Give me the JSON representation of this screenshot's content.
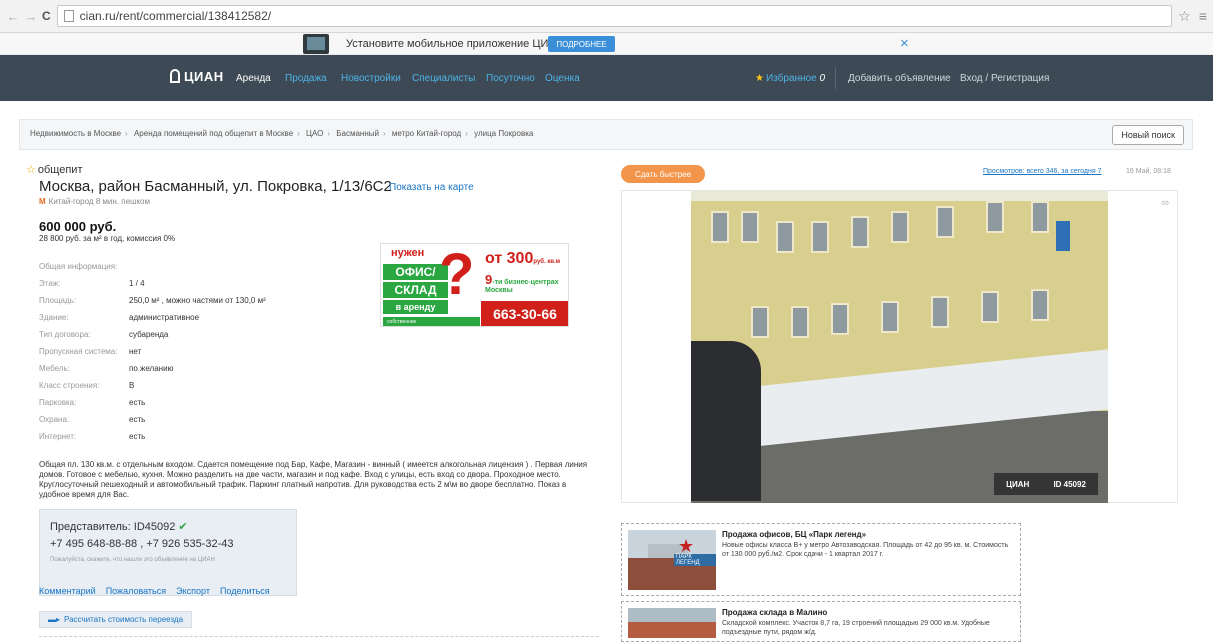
{
  "browser": {
    "url": "cian.ru/rent/commercial/138412582/",
    "back_icon": "←",
    "forward_icon": "→",
    "reload_icon": "C",
    "star_icon": "☆",
    "menu_icon": "≡"
  },
  "promo": {
    "text": "Установите мобильное приложение ЦИАН",
    "button": "ПОДРОБНЕЕ",
    "close": "×"
  },
  "nav": {
    "logo": "ЦИАН",
    "items": [
      "Аренда",
      "Продажа",
      "Новостройки",
      "Специалисты",
      "Посуточно",
      "Оценка"
    ],
    "favorites": "Избранное",
    "favorites_count": "0",
    "add_listing": "Добавить объявление",
    "login": "Вход / Регистрация"
  },
  "breadcrumb": {
    "items": [
      "Недвижимость в Москве",
      "Аренда помещений под общепит в Москве",
      "ЦАО",
      "Басманный",
      "метро Китай-город",
      "улица Покровка"
    ],
    "new_search": "Новый поиск"
  },
  "listing": {
    "category": "общепит",
    "address": "Москва, район Басманный, ул. Покровка, 1/13/6С2",
    "map_link": "Показать на карте",
    "metro": "Китай-город 8 мин. пешком",
    "price": "600 000 руб.",
    "price_sub": "28 800 руб. за м² в год, комиссия 0%",
    "props": [
      {
        "label": "Общая информация:",
        "value": ""
      },
      {
        "label": "Этаж:",
        "value": "1 / 4"
      },
      {
        "label": "Площадь:",
        "value": "250,0 м² , можно частями от 130,0 м²"
      },
      {
        "label": "Здание:",
        "value": "административное"
      },
      {
        "label": "Тип договора:",
        "value": "субаренда"
      },
      {
        "label": "Пропускная система:",
        "value": "нет"
      },
      {
        "label": "Мебель:",
        "value": "по желанию"
      },
      {
        "label": "Класс строения:",
        "value": "B"
      },
      {
        "label": "Парковка:",
        "value": "есть"
      },
      {
        "label": "Охрана:",
        "value": "есть"
      },
      {
        "label": "Интернет:",
        "value": "есть"
      }
    ],
    "description": "Общая пл. 130 кв.м. с отдельным входом. Сдается помещение под Бар, Кафе, Магазин - винный ( имеется алкогольная лицензия ) . Первая линия домов. Готовое с мебелью, кухня. Можно разделить на две части, магазин и под кафе. Вход с улицы, есть вход со двора. Проходное место. Круглосуточный пешеходный и автомобильный трафик. Паркинг платный напротив. Для руководства есть 2 м\\м во дворе бесплатно. Показ в удобное время для Вас."
  },
  "ad_banner": {
    "need": "нужен",
    "office": "ОФИС/",
    "warehouse": "СКЛАД",
    "rent": "в аренду",
    "from": "от 300",
    "from_unit": "руб. кв.м",
    "bc_num": "9",
    "bc_text": "-ти бизнес-центрах Москвы",
    "phone": "663-30-66",
    "owner": "собственник"
  },
  "rep": {
    "title": "Представитель: ID45092",
    "phones": "+7 495 648-88-88 , +7 926 535-32-43",
    "note": "Пожалуйста, скажите, что нашли это объявление на ЦИАН"
  },
  "actions": [
    "Комментарий",
    "Пожаловаться",
    "Экспорт",
    "Поделиться"
  ],
  "move_button": "Рассчитать стоимость переезда",
  "right": {
    "fast_button": "Сдать быстрее",
    "views": "Просмотров: всего 346, за сегодня 7",
    "date": "16 Май, 08:18",
    "photo_watermark": "ЦИАН",
    "photo_id": "ID 45092"
  },
  "ads": [
    {
      "title": "Продажа офисов, БЦ «Парк легенд»",
      "desc": "Новые офисы класса B+ у метро Автозаводская. Площадь от 42 до 95 кв. м. Стоимость от 130 000 руб./м2. Срок сдачи - 1 квартал 2017 г.",
      "thumb_label": "ПАРК ЛЕГЕНД"
    },
    {
      "title": "Продажа склада в Малино",
      "desc": "Складской комплекс. Участок 8,7 га, 19 строений площадью 29 000 кв.м. Удобные подъездные пути, рядом ж/д."
    }
  ]
}
